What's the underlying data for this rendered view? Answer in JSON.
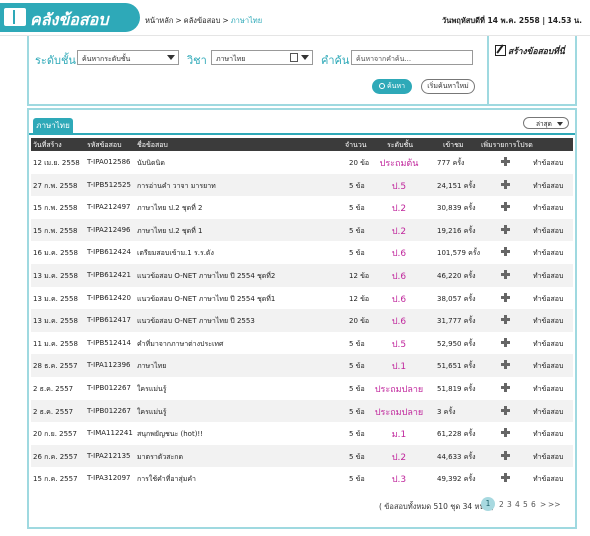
{
  "header": {
    "logo_text": "คลังข้อสอบ",
    "breadcrumb": [
      "หน้าหลัก",
      "คลังข้อสอบ",
      "ภาษาไทย"
    ],
    "datetime": "วันพฤหัสบดีที่ 14 พ.ค. 2558 | 14.53 น."
  },
  "search": {
    "level_label": "ระดับชั้น",
    "level_value": "ค้นหากระดับชั้น",
    "subject_label": "วิชา",
    "subject_value": "ภาษาไทย",
    "keyword_label": "คำค้น",
    "keyword_placeholder": "ค้นหาจากคำค้น...",
    "search_button": "ค้นหา",
    "reset_button": "เริ่มค้นหาใหม่"
  },
  "create": {
    "label": "สร้างข้อสอบที่นี่"
  },
  "results": {
    "tab": "ภาษาไทย",
    "sort_value": "ล่าสุด",
    "columns": [
      "วันที่สร้าง",
      "รหัสข้อสอบ",
      "ชื่อข้อสอบ",
      "จำนวน",
      "ระดับชั้น",
      "เข้าชม",
      "เพิ่มรายการโปรด",
      ""
    ],
    "rows": [
      {
        "date": "12 เม.ย. 2558",
        "code": "T-IPA012586",
        "name": "นับนิดนิด",
        "count": "20 ข้อ",
        "level": "ประถมต้น",
        "views": "777 ครั้ง",
        "action": "ทำข้อสอบ"
      },
      {
        "date": "27 ก.พ. 2558",
        "code": "T-IPB512525",
        "name": "การอ่านคำ วาจา มารยาท",
        "count": "5 ข้อ",
        "level": "ป.5",
        "views": "24,151 ครั้ง",
        "action": "ทำข้อสอบ"
      },
      {
        "date": "15 ก.พ. 2558",
        "code": "T-IPA212497",
        "name": "ภาษาไทย ป.2 ชุดที่ 2",
        "count": "5 ข้อ",
        "level": "ป.2",
        "views": "30,839 ครั้ง",
        "action": "ทำข้อสอบ"
      },
      {
        "date": "15 ก.พ. 2558",
        "code": "T-IPA212496",
        "name": "ภาษาไทย ป.2 ชุดที่ 1",
        "count": "5 ข้อ",
        "level": "ป.2",
        "views": "19,216 ครั้ง",
        "action": "ทำข้อสอบ"
      },
      {
        "date": "16 ม.ค. 2558",
        "code": "T-IPB612424",
        "name": "เตรียมสอบเข้าม.1 ร.ร.ดัง",
        "count": "5 ข้อ",
        "level": "ป.6",
        "views": "101,579 ครั้ง",
        "action": "ทำข้อสอบ"
      },
      {
        "date": "13 ม.ค. 2558",
        "code": "T-IPB612421",
        "name": "แนวข้อสอบ O-NET ภาษาไทย ปี 2554 ชุดที่2",
        "count": "12 ข้อ",
        "level": "ป.6",
        "views": "46,220 ครั้ง",
        "action": "ทำข้อสอบ"
      },
      {
        "date": "13 ม.ค. 2558",
        "code": "T-IPB612420",
        "name": "แนวข้อสอบ O-NET ภาษาไทย ปี 2554 ชุดที่1",
        "count": "12 ข้อ",
        "level": "ป.6",
        "views": "38,057 ครั้ง",
        "action": "ทำข้อสอบ"
      },
      {
        "date": "13 ม.ค. 2558",
        "code": "T-IPB612417",
        "name": "แนวข้อสอบ O-NET ภาษาไทย ปี 2553",
        "count": "20 ข้อ",
        "level": "ป.6",
        "views": "31,777 ครั้ง",
        "action": "ทำข้อสอบ"
      },
      {
        "date": "11 ม.ค. 2558",
        "code": "T-IPB512414",
        "name": "คำที่มาจากภาษาต่างประเทศ",
        "count": "5 ข้อ",
        "level": "ป.5",
        "views": "52,950 ครั้ง",
        "action": "ทำข้อสอบ"
      },
      {
        "date": "28 ธ.ค. 2557",
        "code": "T-IPA112396",
        "name": "ภาษาไทย",
        "count": "5 ข้อ",
        "level": "ป.1",
        "views": "51,651 ครั้ง",
        "action": "ทำข้อสอบ"
      },
      {
        "date": "2 ธ.ค. 2557",
        "code": "T-IPB012267",
        "name": "ใครแม่นรู้",
        "count": "5 ข้อ",
        "level": "ประถมปลาย",
        "views": "51,819 ครั้ง",
        "action": "ทำข้อสอบ"
      },
      {
        "date": "2 ธ.ค. 2557",
        "code": "T-IPB012267",
        "name": "ใครแม่นรู้",
        "count": "5 ข้อ",
        "level": "ประถมปลาย",
        "views": "3 ครั้ง",
        "action": "ทำข้อสอบ"
      },
      {
        "date": "20 ก.ย. 2557",
        "code": "T-IMA112241",
        "name": "สนุกพยัญชนะ (hot)!!",
        "count": "5 ข้อ",
        "level": "ม.1",
        "views": "61,228 ครั้ง",
        "action": "ทำข้อสอบ"
      },
      {
        "date": "26 ก.ค. 2557",
        "code": "T-IPA212135",
        "name": "มาตราตัวสะกด",
        "count": "5 ข้อ",
        "level": "ป.2",
        "views": "44,633 ครั้ง",
        "action": "ทำข้อสอบ"
      },
      {
        "date": "15 ก.ค. 2557",
        "code": "T-IPA312097",
        "name": "การใช้คำที่อาสุ่มคำ",
        "count": "5 ข้อ",
        "level": "ป.3",
        "views": "49,392 ครั้ง",
        "action": "ทำข้อสอบ"
      }
    ]
  },
  "pagination": {
    "info": "( ข้อสอบทั้งหมด 510 ชุด 34 หน้า )",
    "current": "1",
    "pages": [
      "2",
      "3",
      "4",
      "5",
      "6"
    ],
    "next": ">",
    "last": ">>"
  }
}
